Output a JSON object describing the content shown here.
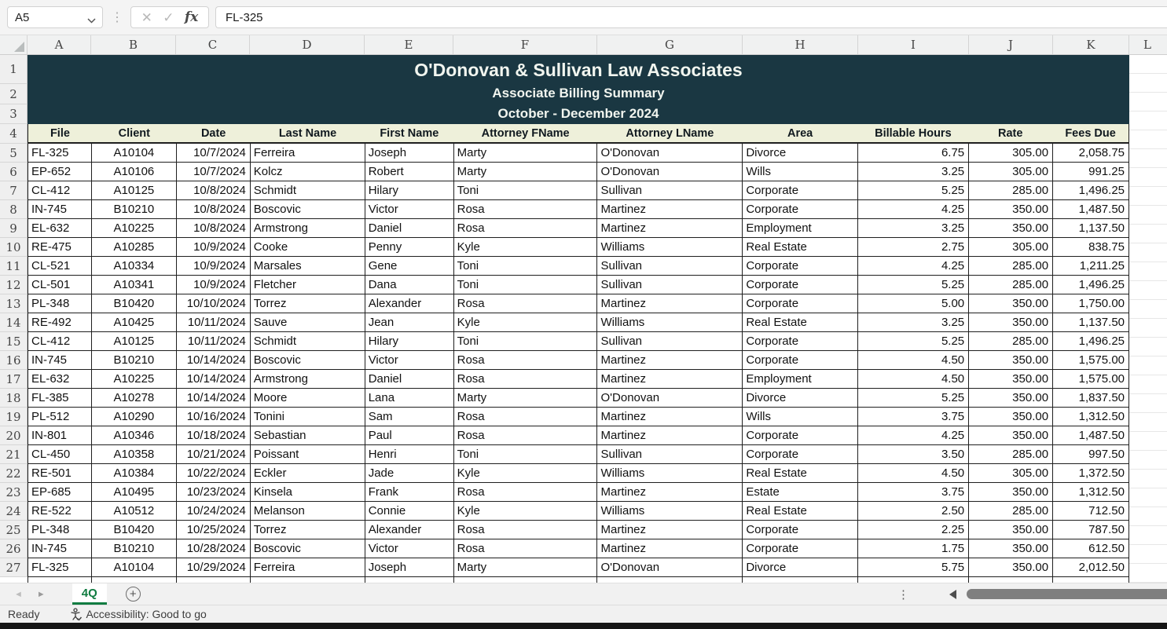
{
  "formula_bar": {
    "name_box_value": "A5",
    "formula_value": "FL-325",
    "cancel_label": "✕",
    "enter_label": "✓",
    "fx_label": "fx"
  },
  "grid": {
    "columns": [
      "A",
      "B",
      "C",
      "D",
      "E",
      "F",
      "G",
      "H",
      "I",
      "J",
      "K",
      "L"
    ],
    "row_numbers": [
      1,
      2,
      3,
      4,
      5,
      6,
      7,
      8,
      9,
      10,
      11,
      12,
      13,
      14,
      15,
      16,
      17,
      18,
      19,
      20,
      21,
      22,
      23,
      24,
      25,
      26,
      27
    ]
  },
  "title": {
    "line1": "O'Donovan & Sullivan Law Associates",
    "line2": "Associate Billing Summary",
    "line3": "October - December 2024"
  },
  "table": {
    "headers": [
      "File",
      "Client",
      "Date",
      "Last Name",
      "First Name",
      "Attorney FName",
      "Attorney LName",
      "Area",
      "Billable Hours",
      "Rate",
      "Fees Due"
    ],
    "rows": [
      [
        "FL-325",
        "A10104",
        "10/7/2024",
        "Ferreira",
        "Joseph",
        "Marty",
        "O'Donovan",
        "Divorce",
        "6.75",
        "305.00",
        "2,058.75"
      ],
      [
        "EP-652",
        "A10106",
        "10/7/2024",
        "Kolcz",
        "Robert",
        "Marty",
        "O'Donovan",
        "Wills",
        "3.25",
        "305.00",
        "991.25"
      ],
      [
        "CL-412",
        "A10125",
        "10/8/2024",
        "Schmidt",
        "Hilary",
        "Toni",
        "Sullivan",
        "Corporate",
        "5.25",
        "285.00",
        "1,496.25"
      ],
      [
        "IN-745",
        "B10210",
        "10/8/2024",
        "Boscovic",
        "Victor",
        "Rosa",
        "Martinez",
        "Corporate",
        "4.25",
        "350.00",
        "1,487.50"
      ],
      [
        "EL-632",
        "A10225",
        "10/8/2024",
        "Armstrong",
        "Daniel",
        "Rosa",
        "Martinez",
        "Employment",
        "3.25",
        "350.00",
        "1,137.50"
      ],
      [
        "RE-475",
        "A10285",
        "10/9/2024",
        "Cooke",
        "Penny",
        "Kyle",
        "Williams",
        "Real Estate",
        "2.75",
        "305.00",
        "838.75"
      ],
      [
        "CL-521",
        "A10334",
        "10/9/2024",
        "Marsales",
        "Gene",
        "Toni",
        "Sullivan",
        "Corporate",
        "4.25",
        "285.00",
        "1,211.25"
      ],
      [
        "CL-501",
        "A10341",
        "10/9/2024",
        "Fletcher",
        "Dana",
        "Toni",
        "Sullivan",
        "Corporate",
        "5.25",
        "285.00",
        "1,496.25"
      ],
      [
        "PL-348",
        "B10420",
        "10/10/2024",
        "Torrez",
        "Alexander",
        "Rosa",
        "Martinez",
        "Corporate",
        "5.00",
        "350.00",
        "1,750.00"
      ],
      [
        "RE-492",
        "A10425",
        "10/11/2024",
        "Sauve",
        "Jean",
        "Kyle",
        "Williams",
        "Real Estate",
        "3.25",
        "350.00",
        "1,137.50"
      ],
      [
        "CL-412",
        "A10125",
        "10/11/2024",
        "Schmidt",
        "Hilary",
        "Toni",
        "Sullivan",
        "Corporate",
        "5.25",
        "285.00",
        "1,496.25"
      ],
      [
        "IN-745",
        "B10210",
        "10/14/2024",
        "Boscovic",
        "Victor",
        "Rosa",
        "Martinez",
        "Corporate",
        "4.50",
        "350.00",
        "1,575.00"
      ],
      [
        "EL-632",
        "A10225",
        "10/14/2024",
        "Armstrong",
        "Daniel",
        "Rosa",
        "Martinez",
        "Employment",
        "4.50",
        "350.00",
        "1,575.00"
      ],
      [
        "FL-385",
        "A10278",
        "10/14/2024",
        "Moore",
        "Lana",
        "Marty",
        "O'Donovan",
        "Divorce",
        "5.25",
        "350.00",
        "1,837.50"
      ],
      [
        "PL-512",
        "A10290",
        "10/16/2024",
        "Tonini",
        "Sam",
        "Rosa",
        "Martinez",
        "Wills",
        "3.75",
        "350.00",
        "1,312.50"
      ],
      [
        "IN-801",
        "A10346",
        "10/18/2024",
        "Sebastian",
        "Paul",
        "Rosa",
        "Martinez",
        "Corporate",
        "4.25",
        "350.00",
        "1,487.50"
      ],
      [
        "CL-450",
        "A10358",
        "10/21/2024",
        "Poissant",
        "Henri",
        "Toni",
        "Sullivan",
        "Corporate",
        "3.50",
        "285.00",
        "997.50"
      ],
      [
        "RE-501",
        "A10384",
        "10/22/2024",
        "Eckler",
        "Jade",
        "Kyle",
        "Williams",
        "Real Estate",
        "4.50",
        "305.00",
        "1,372.50"
      ],
      [
        "EP-685",
        "A10495",
        "10/23/2024",
        "Kinsela",
        "Frank",
        "Rosa",
        "Martinez",
        "Estate",
        "3.75",
        "350.00",
        "1,312.50"
      ],
      [
        "RE-522",
        "A10512",
        "10/24/2024",
        "Melanson",
        "Connie",
        "Kyle",
        "Williams",
        "Real Estate",
        "2.50",
        "285.00",
        "712.50"
      ],
      [
        "PL-348",
        "B10420",
        "10/25/2024",
        "Torrez",
        "Alexander",
        "Rosa",
        "Martinez",
        "Corporate",
        "2.25",
        "350.00",
        "787.50"
      ],
      [
        "IN-745",
        "B10210",
        "10/28/2024",
        "Boscovic",
        "Victor",
        "Rosa",
        "Martinez",
        "Corporate",
        "1.75",
        "350.00",
        "612.50"
      ],
      [
        "FL-325",
        "A10104",
        "10/29/2024",
        "Ferreira",
        "Joseph",
        "Marty",
        "O'Donovan",
        "Divorce",
        "5.75",
        "350.00",
        "2,012.50"
      ]
    ]
  },
  "sheet_tabs": {
    "active_tab": "4Q",
    "add_label": "+"
  },
  "status_bar": {
    "mode": "Ready",
    "accessibility": "Accessibility: Good to go"
  },
  "colors": {
    "title_bg": "#1a3742",
    "header_bg": "#eef0da",
    "tab_green": "#107c41"
  }
}
